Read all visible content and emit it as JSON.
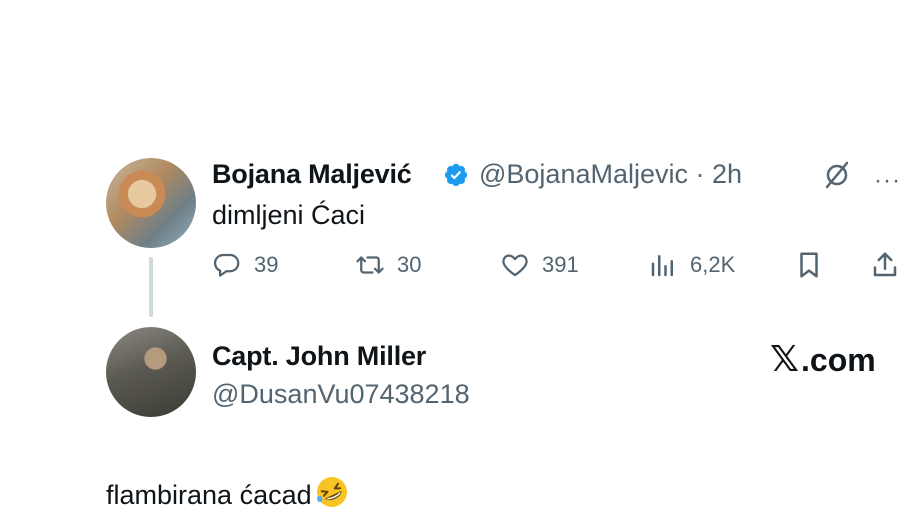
{
  "tweet": {
    "author_name": "Bojana Maljević",
    "handle": "@BojanaMaljevic",
    "separator": "·",
    "time": "2h",
    "text": "dimljeni Ćaci",
    "actions": {
      "replies": "39",
      "reposts": "30",
      "likes": "391",
      "views": "6,2K"
    },
    "more": "···"
  },
  "reply": {
    "author_name": "Capt. John Miller",
    "handle": "@DusanVu07438218",
    "text": "flambirana ćacad"
  },
  "watermark": {
    "logo": "𝕏",
    "domain": ".com"
  },
  "icons": {
    "verified": "verified-badge-icon",
    "grok": "grok-icon",
    "reply": "reply-icon",
    "repost": "repost-icon",
    "like": "heart-icon",
    "views": "views-icon",
    "bookmark": "bookmark-icon",
    "share": "share-icon",
    "emoji": "rolling-on-floor-laughing-emoji"
  },
  "colors": {
    "verified_blue": "#1d9bf0",
    "secondary_text": "#536471",
    "thread_line": "#cfd9de"
  }
}
